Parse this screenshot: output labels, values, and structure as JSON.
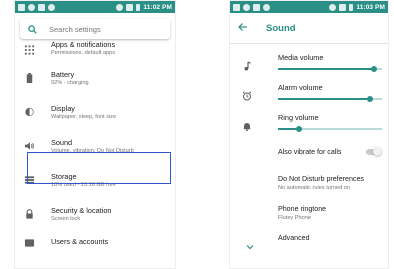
{
  "left_screen": {
    "status_bar": {
      "time": "11:02 PM"
    },
    "search": {
      "placeholder": "Search settings"
    },
    "items": [
      {
        "title": "Apps & notifications",
        "subtitle": "Permissions, default apps",
        "icon": "apps-grid-icon"
      },
      {
        "title": "Battery",
        "subtitle": "92% - charging",
        "icon": "battery-icon"
      },
      {
        "title": "Display",
        "subtitle": "Wallpaper, sleep, font size",
        "icon": "display-brightness-icon"
      },
      {
        "title": "Sound",
        "subtitle": "Volume, vibration, Do Not Disturb",
        "icon": "volume-icon"
      },
      {
        "title": "Storage",
        "subtitle": "18% used - 13.18 GB free",
        "icon": "storage-icon"
      },
      {
        "title": "Security & location",
        "subtitle": "Screen lock",
        "icon": "lock-icon"
      },
      {
        "title": "Users & accounts",
        "subtitle": "",
        "icon": "users-icon"
      }
    ],
    "highlight_color": "#2f55d4"
  },
  "right_screen": {
    "status_bar": {
      "time": "11:03 PM"
    },
    "title": "Sound",
    "accent_color": "#2a8f86",
    "volumes": [
      {
        "label": "Media volume",
        "level": 0.92,
        "icon": "music-note-icon"
      },
      {
        "label": "Alarm volume",
        "level": 0.88,
        "icon": "alarm-clock-icon"
      },
      {
        "label": "Ring volume",
        "level": 0.2,
        "icon": "bell-icon"
      }
    ],
    "vibrate": {
      "label": "Also vibrate for calls",
      "enabled": false
    },
    "dnd": {
      "title": "Do Not Disturb preferences",
      "subtitle": "No automatic rules turned on"
    },
    "ringtone": {
      "title": "Phone ringtone",
      "subtitle": "Flutey Phone"
    },
    "advanced": {
      "title": "Advanced"
    }
  }
}
